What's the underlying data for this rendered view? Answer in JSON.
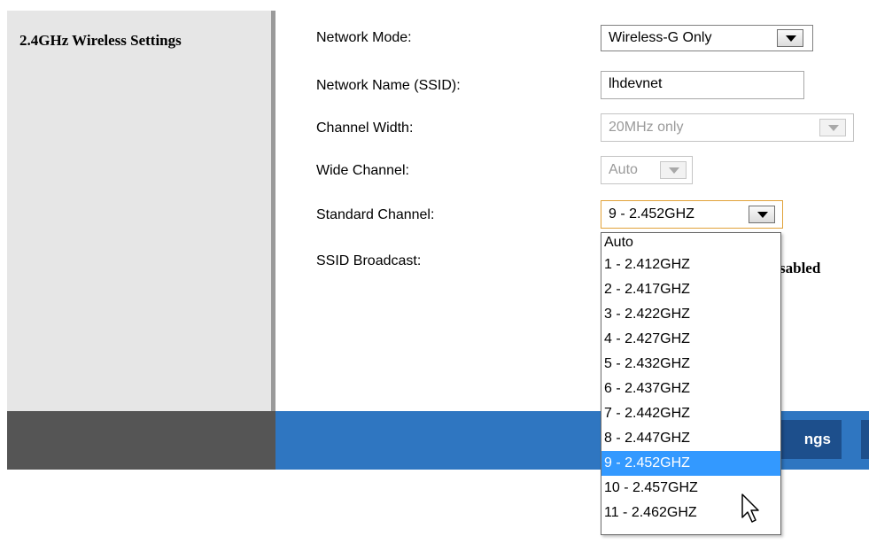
{
  "section": {
    "title": "2.4GHz Wireless Settings"
  },
  "fields": {
    "network_mode": {
      "label": "Network Mode:",
      "value": "Wireless-G Only"
    },
    "ssid": {
      "label": "Network Name (SSID):",
      "value": "lhdevnet"
    },
    "channel_width": {
      "label": "Channel Width:",
      "value": "20MHz only"
    },
    "wide_channel": {
      "label": "Wide Channel:",
      "value": "Auto"
    },
    "standard_channel": {
      "label": "Standard Channel:",
      "value": "9 - 2.452GHZ"
    },
    "ssid_broadcast": {
      "label": "SSID Broadcast:",
      "partial_option": "sabled"
    }
  },
  "footer": {
    "save_label": "ngs"
  },
  "dropdown": {
    "options": [
      "Auto",
      "1 - 2.412GHZ",
      "2 - 2.417GHZ",
      "3 - 2.422GHZ",
      "4 - 2.427GHZ",
      "5 - 2.432GHZ",
      "6 - 2.437GHZ",
      "7 - 2.442GHZ",
      "8 - 2.447GHZ",
      "9 - 2.452GHZ",
      "10 - 2.457GHZ",
      "11 - 2.462GHZ"
    ],
    "selected_index": 9
  },
  "icons": {
    "pointer": "mouse-pointer-icon",
    "arrow": "chevron-down-icon"
  }
}
